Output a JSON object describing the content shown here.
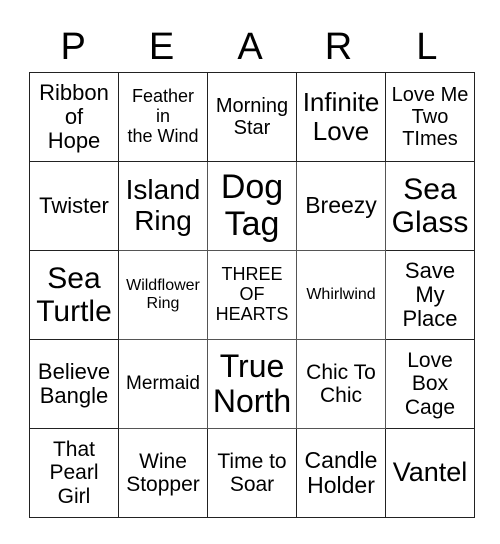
{
  "title_letters": [
    "P",
    "E",
    "A",
    "R",
    "L"
  ],
  "rows": [
    [
      {
        "text": "Ribbon\nof\nHope",
        "size": 22
      },
      {
        "text": "Feather\nin\nthe Wind",
        "size": 18
      },
      {
        "text": "Morning\nStar",
        "size": 20
      },
      {
        "text": "Infinite\nLove",
        "size": 26
      },
      {
        "text": "Love Me\nTwo\nTImes",
        "size": 20
      }
    ],
    [
      {
        "text": "Twister",
        "size": 22
      },
      {
        "text": "Island\nRing",
        "size": 28
      },
      {
        "text": "Dog\nTag",
        "size": 34
      },
      {
        "text": "Breezy",
        "size": 23
      },
      {
        "text": "Sea\nGlass",
        "size": 30
      }
    ],
    [
      {
        "text": "Sea\nTurtle",
        "size": 30
      },
      {
        "text": "Wildflower\nRing",
        "size": 16
      },
      {
        "text": "THREE\nOF\nHEARTS",
        "size": 18
      },
      {
        "text": "Whirlwind",
        "size": 16
      },
      {
        "text": "Save\nMy\nPlace",
        "size": 22
      }
    ],
    [
      {
        "text": "Believe\nBangle",
        "size": 22
      },
      {
        "text": "Mermaid",
        "size": 19
      },
      {
        "text": "True\nNorth",
        "size": 32
      },
      {
        "text": "Chic To\nChic",
        "size": 21
      },
      {
        "text": "Love\nBox\nCage",
        "size": 21
      }
    ],
    [
      {
        "text": "That\nPearl\nGirl",
        "size": 21
      },
      {
        "text": "Wine\nStopper",
        "size": 21
      },
      {
        "text": "Time to\nSoar",
        "size": 21
      },
      {
        "text": "Candle\nHolder",
        "size": 23
      },
      {
        "text": "Vantel",
        "size": 27
      }
    ]
  ]
}
